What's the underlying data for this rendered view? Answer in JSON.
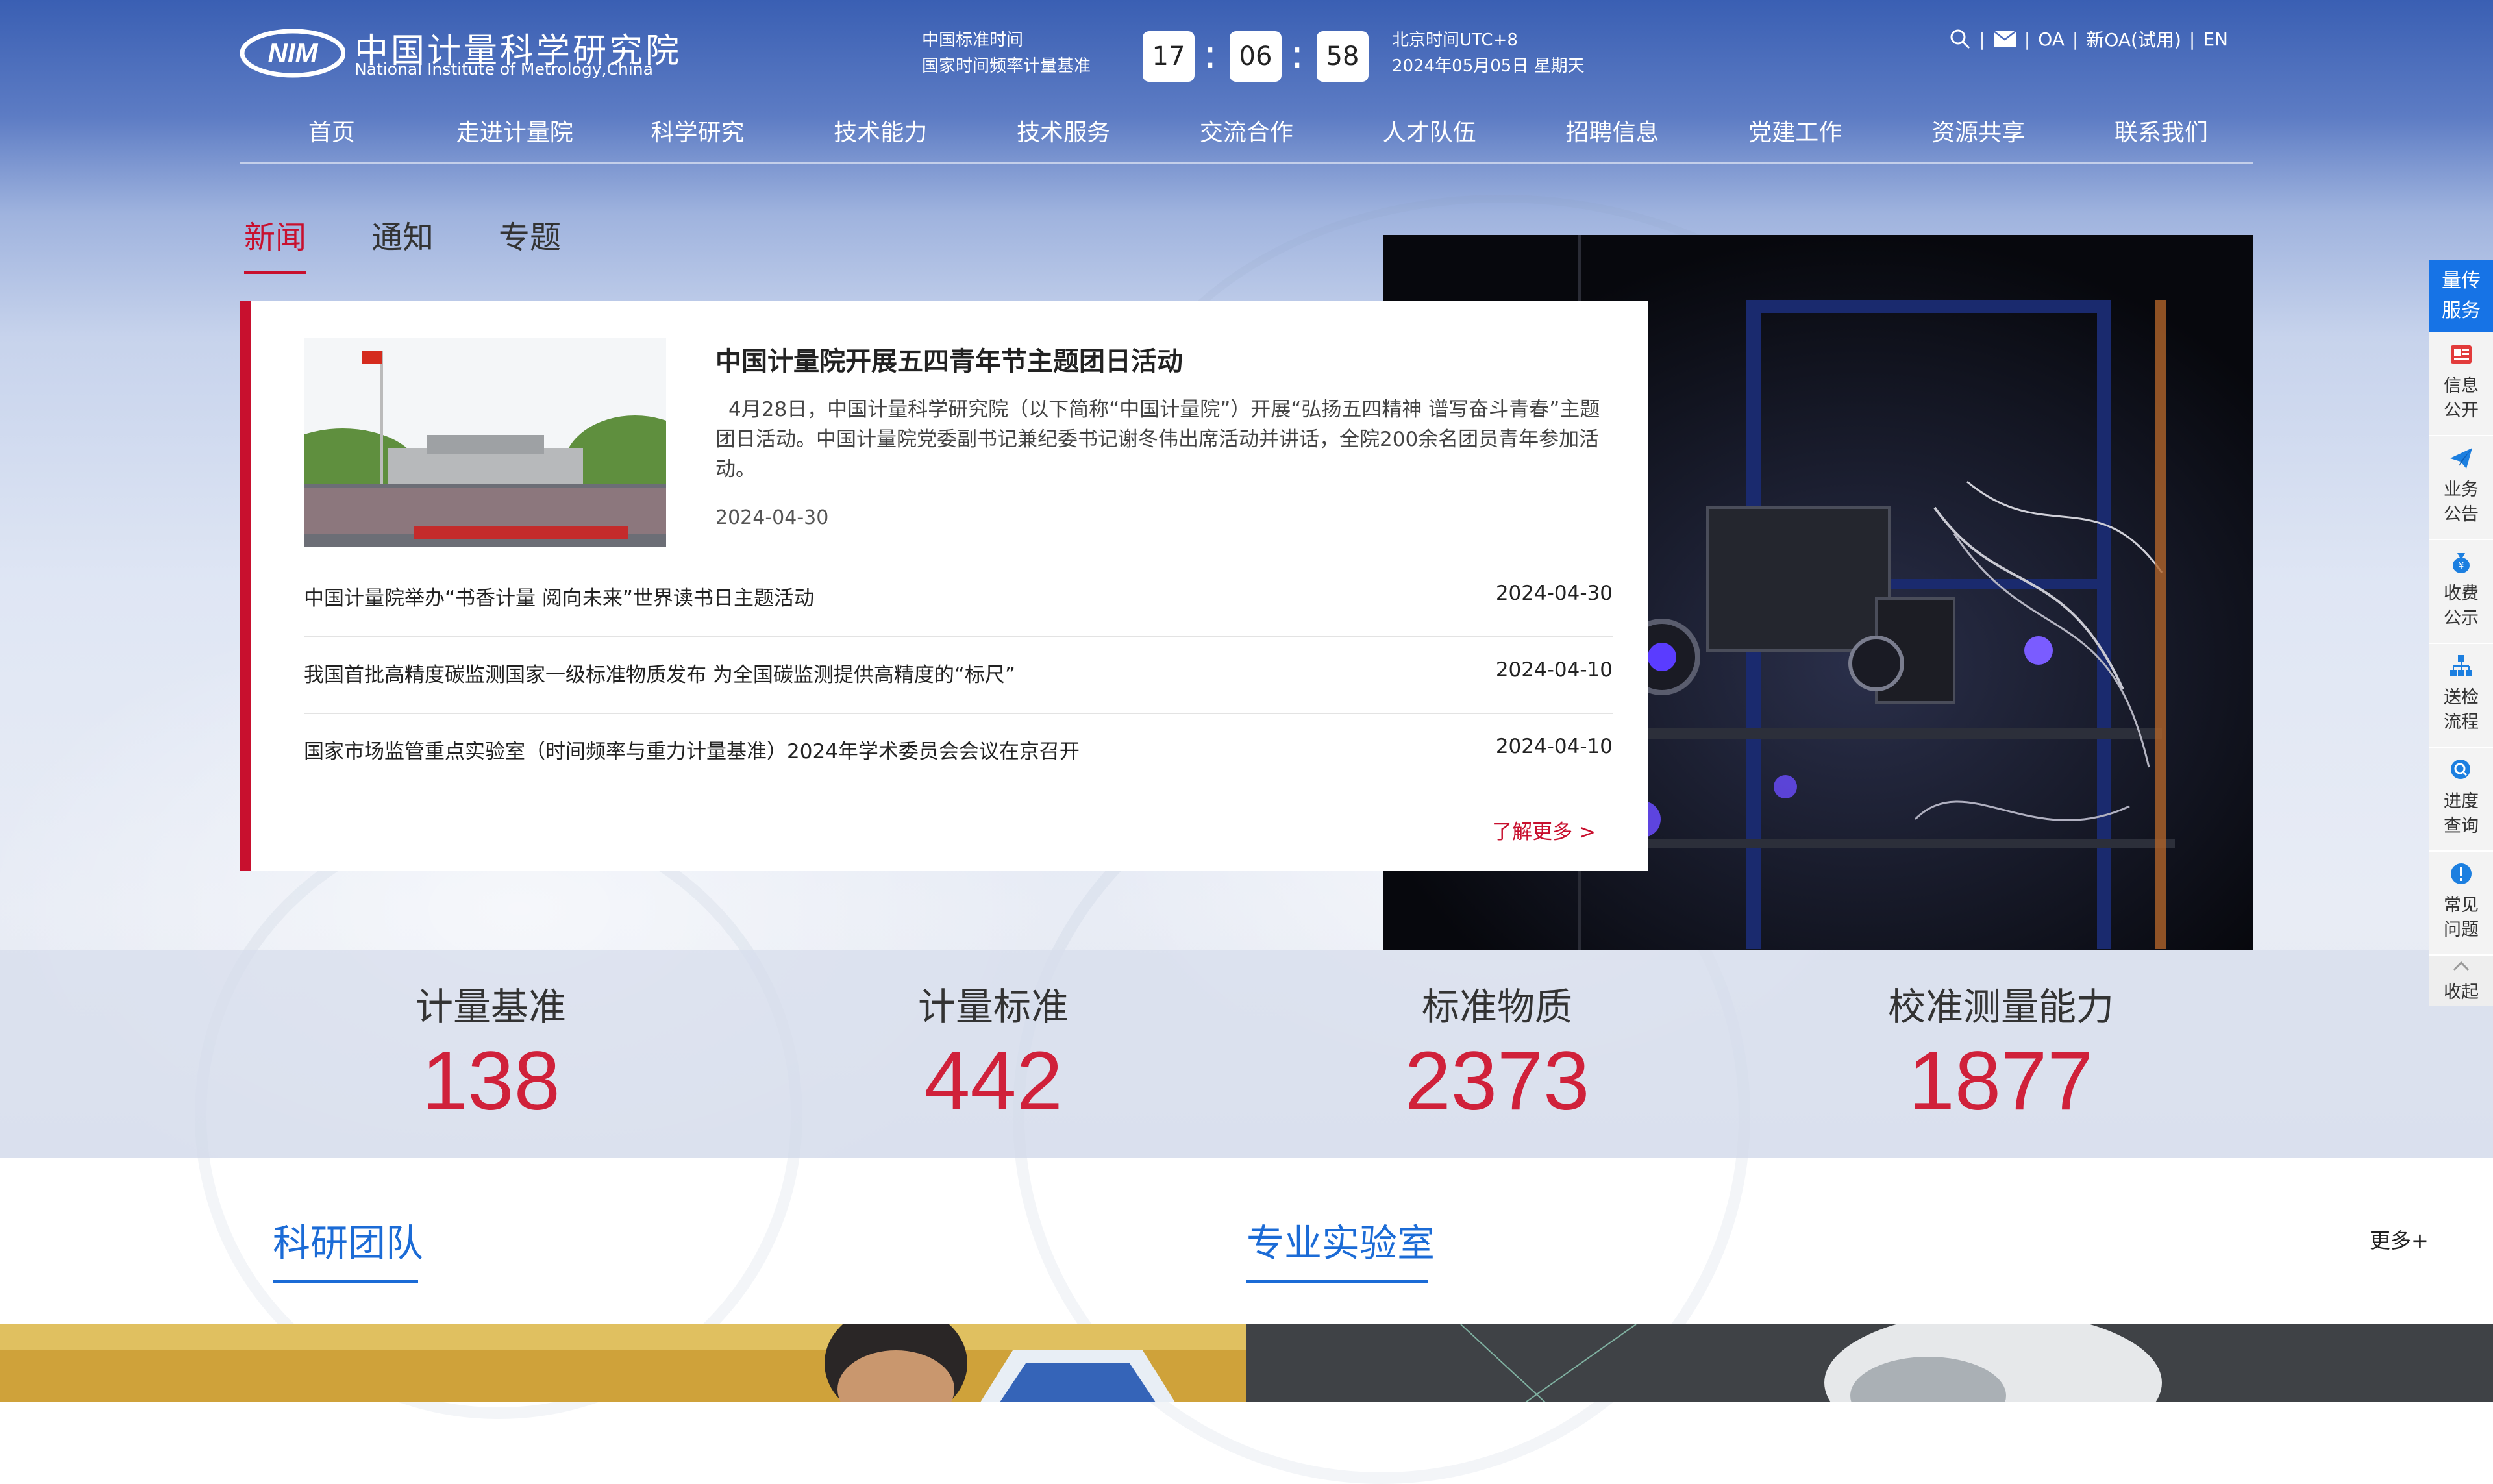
{
  "header": {
    "logo_cn": "中国计量科学研究院",
    "logo_en": "National Institute of Metrology,China",
    "clock": {
      "left_line1": "中国标准时间",
      "left_line2": "国家时间频率计量基准",
      "hours": "17",
      "minutes": "06",
      "seconds": "58",
      "right_line1": "北京时间UTC+8",
      "right_line2": "2024年05月05日 星期天"
    },
    "top_links": {
      "oa": "OA",
      "new_oa": "新OA(试用)",
      "en": "EN",
      "sep": "|"
    }
  },
  "nav": [
    "首页",
    "走进计量院",
    "科学研究",
    "技术能力",
    "技术服务",
    "交流合作",
    "人才队伍",
    "招聘信息",
    "党建工作",
    "资源共享",
    "联系我们"
  ],
  "news": {
    "tabs": [
      "新闻",
      "通知",
      "专题"
    ],
    "featured": {
      "title": "中国计量院开展五四青年节主题团日活动",
      "body": "4月28日，中国计量科学研究院（以下简称“中国计量院”）开展“弘扬五四精神 谱写奋斗青春”主题团日活动。中国计量院党委副书记兼纪委书记谢冬伟出席活动并讲话，全院200余名团员青年参加活动。",
      "date": "2024-04-30"
    },
    "items": [
      {
        "title": "中国计量院举办“书香计量 阅向未来”世界读书日主题活动",
        "date": "2024-04-30"
      },
      {
        "title": "我国首批高精度碳监测国家一级标准物质发布 为全国碳监测提供高精度的“标尺”",
        "date": "2024-04-10"
      },
      {
        "title": "国家市场监管重点实验室（时间频率与重力计量基准）2024年学术委员会会议在京召开",
        "date": "2024-04-10"
      }
    ],
    "more": "了解更多 >"
  },
  "stats": [
    {
      "label": "计量基准",
      "value": "138"
    },
    {
      "label": "计量标准",
      "value": "442"
    },
    {
      "label": "标准物质",
      "value": "2373"
    },
    {
      "label": "校准测量能力",
      "value": "1877"
    }
  ],
  "sections": {
    "team": "科研团队",
    "labs": "专业实验室",
    "more": "更多+"
  },
  "sidebar": {
    "header_line1": "量传",
    "header_line2": "服务",
    "items": [
      {
        "line1": "信息",
        "line2": "公开",
        "icon": "info-disclosure-icon"
      },
      {
        "line1": "业务",
        "line2": "公告",
        "icon": "paper-plane-icon"
      },
      {
        "line1": "收费",
        "line2": "公示",
        "icon": "money-bag-icon"
      },
      {
        "line1": "送检",
        "line2": "流程",
        "icon": "flowchart-icon"
      },
      {
        "line1": "进度",
        "line2": "查询",
        "icon": "magnifier-icon"
      },
      {
        "line1": "常见",
        "line2": "问题",
        "icon": "exclamation-icon"
      }
    ],
    "collapse": "收起"
  },
  "colors": {
    "accent_red": "#c8102e",
    "number_red": "#d0213a",
    "link_blue": "#1b6bd6",
    "sidebar_blue": "#1673e6"
  }
}
